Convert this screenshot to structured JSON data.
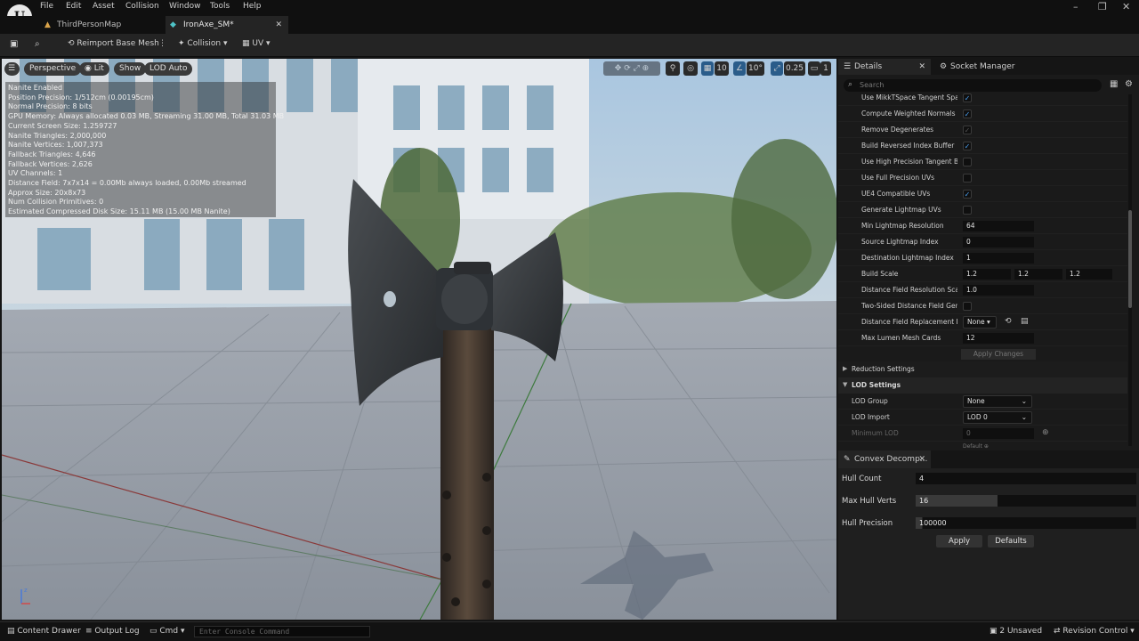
{
  "menu": [
    "File",
    "Edit",
    "Asset",
    "Collision",
    "Window",
    "Tools",
    "Help"
  ],
  "tabs": [
    {
      "label": "ThirdPersonMap"
    },
    {
      "label": "IronAxe_SM*"
    }
  ],
  "toolbar": {
    "reimport": "Reimport Base Mesh",
    "collision": "Collision",
    "uv": "UV"
  },
  "viewport": {
    "buttons": {
      "perspective": "Perspective",
      "lit": "Lit",
      "show": "Show",
      "lod": "LOD Auto"
    },
    "right": {
      "grid": "10",
      "angle": "10°",
      "scale": "0.25",
      "camera": "1"
    },
    "stats": [
      "Nanite Enabled",
      "Position Precision: 1/512cm (0.00195cm)",
      "Normal Precision: 8 bits",
      "GPU Memory: Always allocated 0.03 MB, Streaming 31.00 MB, Total 31.03 MB",
      "Current Screen Size: 1.259727",
      "Nanite Triangles: 2,000,000",
      "Nanite Vertices: 1,007,373",
      "Fallback Triangles: 4,646",
      "Fallback Vertices: 2,626",
      "UV Channels: 1",
      "Distance Field: 7x7x14 = 0.00Mb always loaded, 0.00Mb streamed",
      "Approx Size: 20x8x73",
      "Num Collision Primitives: 0",
      "Estimated Compressed Disk Size: 15.11 MB (15.00 MB Nanite)"
    ]
  },
  "details": {
    "tab_details": "Details",
    "tab_socket": "Socket Manager",
    "search_placeholder": "Search",
    "rows": [
      {
        "label": "Use MikkTSpace Tangent Space",
        "checked": true
      },
      {
        "label": "Compute Weighted Normals",
        "checked": true
      },
      {
        "label": "Remove Degenerates",
        "checked": true
      },
      {
        "label": "Build Reversed Index Buffer",
        "checked": true
      },
      {
        "label": "Use High Precision Tangent Basis",
        "checked": false
      },
      {
        "label": "Use Full Precision UVs",
        "checked": false
      },
      {
        "label": "UE4 Compatible UVs",
        "checked": true
      },
      {
        "label": "Generate Lightmap UVs",
        "checked": false
      }
    ],
    "min_lightmap_label": "Min Lightmap Resolution",
    "min_lightmap_value": "64",
    "source_lightmap_label": "Source Lightmap Index",
    "source_lightmap_value": "0",
    "dest_lightmap_label": "Destination Lightmap Index",
    "dest_lightmap_value": "1",
    "build_scale_label": "Build Scale",
    "build_scale": [
      "1.2",
      "1.2",
      "1.2"
    ],
    "df_res_label": "Distance Field Resolution Scale",
    "df_res_value": "1.0",
    "two_sided_label": "Two-Sided Distance Field Generation",
    "df_replace_label": "Distance Field Replacement Mesh",
    "df_replace_value": "None",
    "max_lumen_label": "Max Lumen Mesh Cards",
    "max_lumen_value": "12",
    "apply_changes": "Apply Changes",
    "reduction": "Reduction Settings",
    "lod_settings": "LOD Settings",
    "lod_group_label": "LOD Group",
    "lod_group_value": "None",
    "lod_import_label": "LOD Import",
    "lod_import_value": "LOD 0",
    "min_lod_label": "Minimum LOD",
    "min_lod_value": "0",
    "default_label": "Default"
  },
  "convex": {
    "title": "Convex Decomp...",
    "hull_count_label": "Hull Count",
    "hull_count": "4",
    "max_verts_label": "Max Hull Verts",
    "max_verts": "16",
    "precision_label": "Hull Precision",
    "precision": "100000",
    "apply": "Apply",
    "defaults": "Defaults"
  },
  "status": {
    "content_drawer": "Content Drawer",
    "output_log": "Output Log",
    "cmd": "Cmd",
    "console_placeholder": "Enter Console Command",
    "unsaved": "2 Unsaved",
    "revision": "Revision Control"
  },
  "colors": {
    "accent": "#4aa0f0",
    "panel": "#1a1a1a",
    "toolbar": "#242424"
  }
}
